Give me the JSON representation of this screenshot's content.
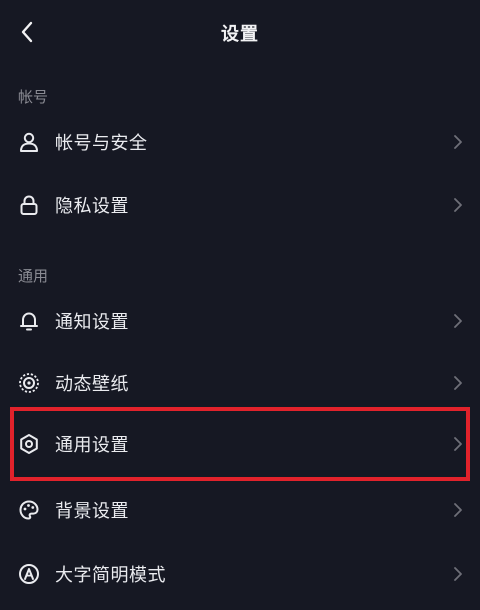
{
  "header": {
    "title": "设置"
  },
  "sections": [
    {
      "label": "帐号",
      "items": [
        {
          "label": "帐号与安全",
          "icon": "user-icon"
        },
        {
          "label": "隐私设置",
          "icon": "lock-icon"
        }
      ]
    },
    {
      "label": "通用",
      "items": [
        {
          "label": "通知设置",
          "icon": "bell-icon"
        },
        {
          "label": "动态壁纸",
          "icon": "live-wallpaper-icon"
        },
        {
          "label": "通用设置",
          "icon": "gear-icon"
        },
        {
          "label": "背景设置",
          "icon": "palette-icon"
        },
        {
          "label": "大字简明模式",
          "icon": "text-size-icon"
        }
      ]
    }
  ],
  "colors": {
    "background": "#161823",
    "text": "#eaebef",
    "section_label": "#8a8b93",
    "chevron": "#6e6f78",
    "highlight": "#e1222b"
  }
}
